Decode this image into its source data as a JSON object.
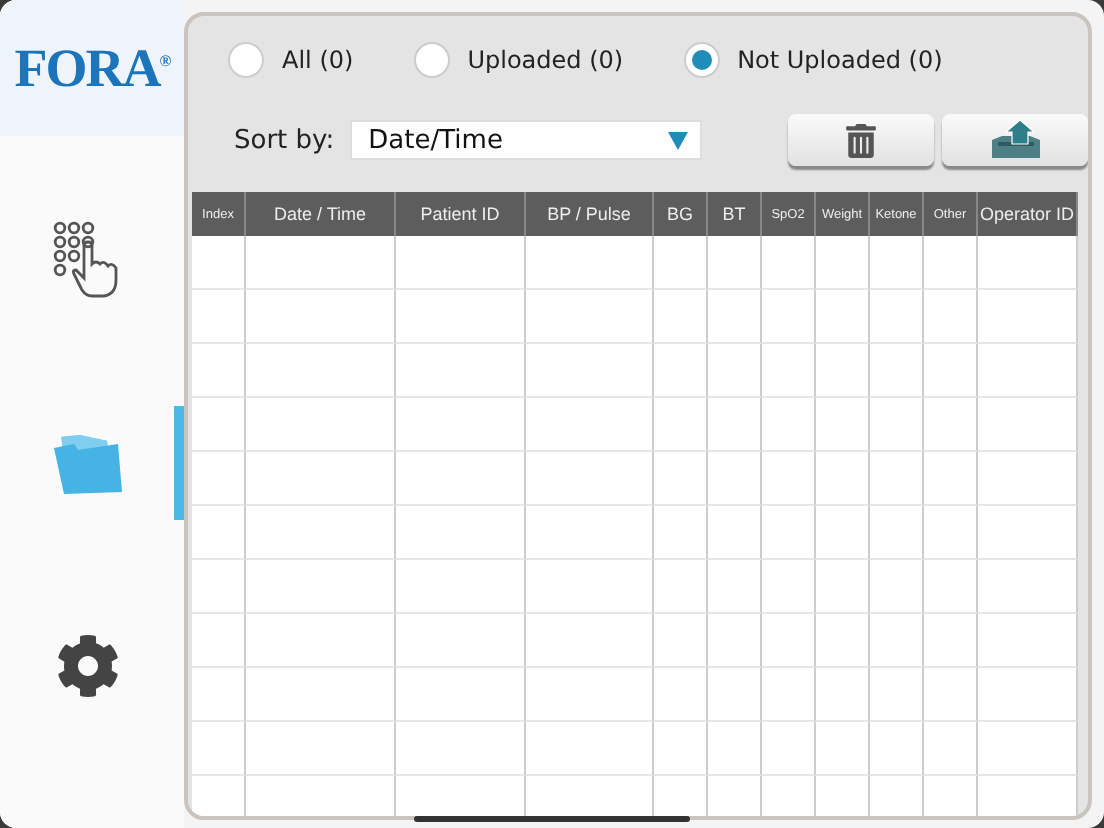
{
  "logo": {
    "text": "FORA",
    "mark": "®"
  },
  "sidebar": {
    "items": [
      {
        "kind": "keypad",
        "selected": false
      },
      {
        "kind": "folder",
        "selected": true
      },
      {
        "kind": "settings",
        "selected": false
      }
    ]
  },
  "filter": [
    {
      "label": "All (0)",
      "selected": false
    },
    {
      "label": "Uploaded (0)",
      "selected": false
    },
    {
      "label": "Not Uploaded (0)",
      "selected": true
    }
  ],
  "sort": {
    "label": "Sort by:",
    "value": "Date/Time"
  },
  "table": {
    "columns": [
      "Index",
      "Date / Time",
      "Patient ID",
      "BP / Pulse",
      "BG",
      "BT",
      "SpO2",
      "Weight",
      "Ketone",
      "Other",
      "Operator ID"
    ]
  }
}
